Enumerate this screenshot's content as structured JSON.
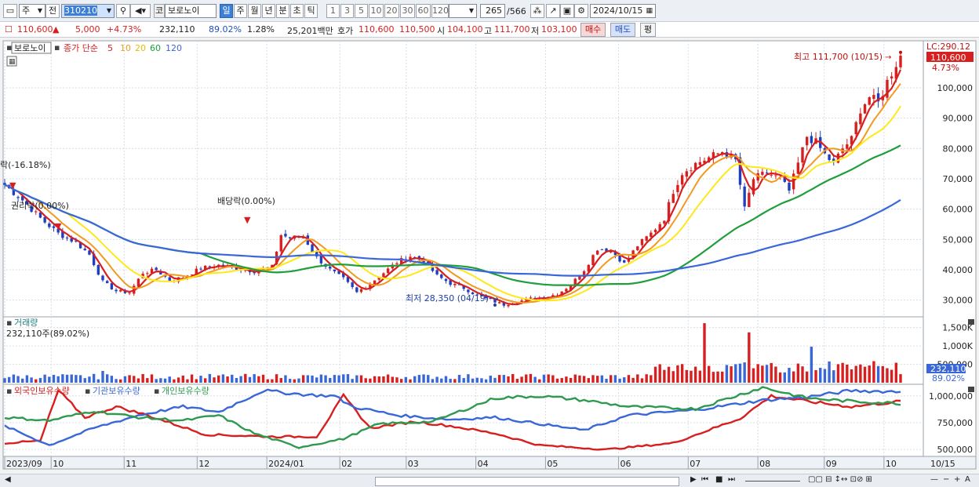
{
  "toolbar": {
    "market_select": "주",
    "prev_label": "전",
    "code_value": "310210",
    "market_badge": "코",
    "stock_name": "보로노이",
    "periods": [
      "일",
      "주",
      "월",
      "년",
      "분",
      "초",
      "틱"
    ],
    "active_period": "일",
    "intervals": [
      "1",
      "3",
      "5",
      "10",
      "20",
      "30",
      "60",
      "120"
    ],
    "count_value": "265",
    "count_total": "/566",
    "date_value": "2024/10/15"
  },
  "quote": {
    "price": "110,600",
    "change": "5,000",
    "change_pct": "+4.73%",
    "volume": "232,110",
    "vol_ratio": "89.02%",
    "turnover": "1.28%",
    "amount": "25,201백만",
    "hoga_label": "호가",
    "hoga_ask": "110,600",
    "hoga_bid": "110,500",
    "open_label": "시",
    "open": "104,100",
    "high_label": "고",
    "high": "111,700",
    "low_label": "저",
    "low": "103,100",
    "buy_label": "매수",
    "sell_label": "매도",
    "eval_label": "평"
  },
  "price_panel": {
    "legend_name": "보로노이",
    "legend_ma_label": "종가 단순",
    "ma_periods": [
      "5",
      "10",
      "20",
      "60",
      "120"
    ],
    "ma_colors": [
      "#d81f1f",
      "#f29a1f",
      "#ffe81a",
      "#1f9e3a",
      "#3a67d8"
    ],
    "lc_label": "LC:290.12",
    "last_price_label": "110,600",
    "last_pct_label": "4.73%",
    "max_annotation": "최고 111,700 (10/15)",
    "min_annotation": "최저 28,350 (04/19)",
    "event_annotations": [
      "락(-16.18%)",
      "권리락(0.00%)",
      "배당락(0.00%)"
    ]
  },
  "volume_panel": {
    "title": "거래량",
    "sub": "232,110주(89.02%)",
    "last_label": "232,110",
    "last_pct": "89.02%"
  },
  "holdings_panel": {
    "legend": [
      "외국인보유수량",
      "기관보유수량",
      "개인보유수량"
    ],
    "colors": [
      "#d81f1f",
      "#3a67d8",
      "#2f9a4f"
    ]
  },
  "x_axis": {
    "labels": [
      "2023/09",
      "10",
      "11",
      "12",
      "2024/01",
      "02",
      "03",
      "04",
      "05",
      "06",
      "07",
      "08",
      "09",
      "10"
    ],
    "right_label": "10/15"
  },
  "chart_data": [
    {
      "type": "candlestick",
      "title": "",
      "y_ticks": [
        30000,
        40000,
        50000,
        60000,
        70000,
        80000,
        90000,
        100000
      ],
      "ylim": [
        25000,
        115000
      ],
      "max_point": {
        "value": 111700,
        "date": "10/15"
      },
      "min_point": {
        "value": 28350,
        "date": "04/19"
      },
      "close_trend": [
        [
          0,
          68000
        ],
        [
          4,
          63000
        ],
        [
          8,
          57000
        ],
        [
          12,
          52000
        ],
        [
          16,
          49000
        ],
        [
          19,
          45000
        ],
        [
          22,
          36000
        ],
        [
          25,
          33000
        ],
        [
          28,
          32500
        ],
        [
          31,
          39000
        ],
        [
          34,
          40000
        ],
        [
          37,
          36500
        ],
        [
          40,
          37500
        ],
        [
          44,
          40500
        ],
        [
          48,
          41500
        ],
        [
          52,
          40500
        ],
        [
          56,
          39500
        ],
        [
          60,
          41000
        ],
        [
          62,
          51500
        ],
        [
          64,
          50500
        ],
        [
          67,
          51000
        ],
        [
          70,
          44000
        ],
        [
          73,
          40000
        ],
        [
          76,
          37000
        ],
        [
          79,
          32500
        ],
        [
          82,
          35500
        ],
        [
          85,
          39000
        ],
        [
          88,
          42500
        ],
        [
          91,
          44500
        ],
        [
          94,
          43000
        ],
        [
          97,
          38000
        ],
        [
          100,
          35500
        ],
        [
          103,
          34000
        ],
        [
          106,
          31500
        ],
        [
          109,
          30000
        ],
        [
          112,
          28500
        ],
        [
          115,
          29500
        ],
        [
          118,
          30500
        ],
        [
          121,
          31000
        ],
        [
          124,
          32000
        ],
        [
          127,
          35000
        ],
        [
          130,
          40000
        ],
        [
          133,
          47000
        ],
        [
          136,
          46500
        ],
        [
          139,
          42000
        ],
        [
          142,
          48000
        ],
        [
          145,
          52000
        ],
        [
          148,
          57000
        ],
        [
          150,
          66000
        ],
        [
          152,
          72000
        ],
        [
          155,
          75000
        ],
        [
          158,
          77000
        ],
        [
          161,
          79000
        ],
        [
          164,
          76000
        ],
        [
          166,
          60000
        ],
        [
          168,
          70000
        ],
        [
          171,
          72000
        ],
        [
          174,
          70000
        ],
        [
          176,
          66000
        ],
        [
          178,
          75000
        ],
        [
          180,
          84000
        ],
        [
          182,
          82000
        ],
        [
          184,
          78000
        ],
        [
          186,
          75000
        ],
        [
          188,
          80000
        ],
        [
          190,
          83000
        ],
        [
          192,
          93000
        ],
        [
          194,
          97000
        ],
        [
          196,
          95000
        ],
        [
          198,
          102000
        ],
        [
          200,
          108000
        ],
        [
          201,
          110600
        ]
      ],
      "ma_current": {
        "ma5": 104000,
        "ma10": 101000,
        "ma20": 94000,
        "ma60": 81500,
        "ma120": 61500
      }
    },
    {
      "type": "bar",
      "title": "",
      "y_ticks": [
        "500,000",
        "1,000K",
        "1,500K"
      ],
      "ylim": [
        0,
        1750000
      ],
      "notable_spikes": [
        {
          "x": 22,
          "value": 320000
        },
        {
          "x": 157,
          "value": 1620000
        },
        {
          "x": 167,
          "value": 1370000
        },
        {
          "x": 181,
          "value": 980000
        },
        {
          "x": 201,
          "value": 232110
        }
      ]
    },
    {
      "type": "line",
      "title": "",
      "y_ticks": [
        500000,
        750000,
        1000000
      ],
      "ylim": [
        450000,
        1080000
      ],
      "series": [
        {
          "name": "외국인보유수량",
          "values": [
            [
              0,
              560000
            ],
            [
              8,
              580000
            ],
            [
              12,
              1050000
            ],
            [
              18,
              800000
            ],
            [
              25,
              900000
            ],
            [
              32,
              820000
            ],
            [
              45,
              640000
            ],
            [
              60,
              620000
            ],
            [
              70,
              620000
            ],
            [
              76,
              1000000
            ],
            [
              82,
              700000
            ],
            [
              92,
              760000
            ],
            [
              100,
              720000
            ],
            [
              110,
              650000
            ],
            [
              120,
              540000
            ],
            [
              135,
              500000
            ],
            [
              150,
              560000
            ],
            [
              165,
              790000
            ],
            [
              172,
              1000000
            ],
            [
              180,
              950000
            ],
            [
              190,
              900000
            ],
            [
              201,
              950000
            ]
          ]
        },
        {
          "name": "기관보유수량",
          "values": [
            [
              0,
              720000
            ],
            [
              10,
              540000
            ],
            [
              20,
              700000
            ],
            [
              30,
              820000
            ],
            [
              40,
              900000
            ],
            [
              48,
              850000
            ],
            [
              58,
              1050000
            ],
            [
              68,
              1010000
            ],
            [
              74,
              1000000
            ],
            [
              78,
              900000
            ],
            [
              88,
              820000
            ],
            [
              100,
              780000
            ],
            [
              110,
              800000
            ],
            [
              120,
              740000
            ],
            [
              130,
              680000
            ],
            [
              140,
              820000
            ],
            [
              155,
              870000
            ],
            [
              170,
              960000
            ],
            [
              180,
              990000
            ],
            [
              190,
              1050000
            ],
            [
              201,
              1040000
            ]
          ]
        },
        {
          "name": "개인보유수량",
          "values": [
            [
              0,
              800000
            ],
            [
              10,
              770000
            ],
            [
              20,
              860000
            ],
            [
              30,
              800000
            ],
            [
              40,
              770000
            ],
            [
              48,
              820000
            ],
            [
              56,
              650000
            ],
            [
              66,
              520000
            ],
            [
              76,
              600000
            ],
            [
              84,
              740000
            ],
            [
              96,
              760000
            ],
            [
              110,
              980000
            ],
            [
              120,
              1000000
            ],
            [
              130,
              960000
            ],
            [
              140,
              900000
            ],
            [
              155,
              880000
            ],
            [
              170,
              1080000
            ],
            [
              180,
              980000
            ],
            [
              190,
              950000
            ],
            [
              201,
              930000
            ]
          ]
        }
      ]
    }
  ]
}
